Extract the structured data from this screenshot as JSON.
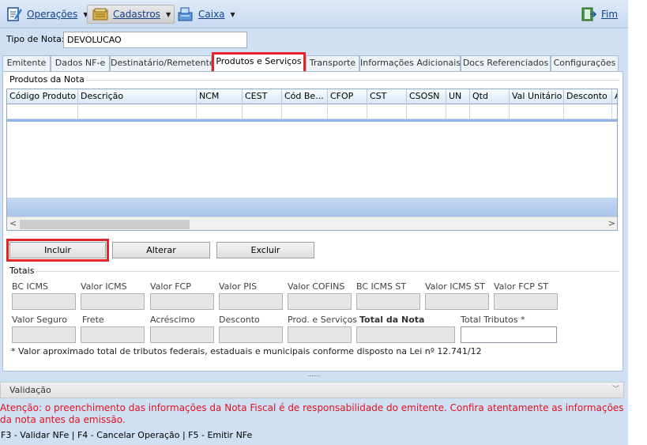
{
  "menubar": {
    "items": [
      {
        "label": "Operações",
        "icon": "operations-icon",
        "active": false
      },
      {
        "label": "Cadastros",
        "icon": "register-icon",
        "active": true
      },
      {
        "label": "Caixa",
        "icon": "cash-register-icon",
        "active": false
      }
    ],
    "exit_label": "Fim"
  },
  "tipo_nota": {
    "label": "Tipo de Nota:",
    "value": "DEVOLUCAO"
  },
  "tabs": [
    {
      "label": "Emitente"
    },
    {
      "label": "Dados NF-e"
    },
    {
      "label": "Destinatário/Remetente"
    },
    {
      "label": "Produtos e Serviços",
      "active": true
    },
    {
      "label": "Transporte"
    },
    {
      "label": "Informações Adicionais"
    },
    {
      "label": "Docs Referenciados"
    },
    {
      "label": "Configurações"
    }
  ],
  "produtos": {
    "group_title": "Produtos da Nota",
    "columns": [
      "Código Produto",
      "Descrição",
      "NCM",
      "CEST",
      "Cód Be...",
      "CFOP",
      "CST",
      "CSOSN",
      "UN",
      "Qtd",
      "Val Unitário",
      "Desconto",
      "A"
    ]
  },
  "actions": {
    "incluir": "Incluir",
    "alterar": "Alterar",
    "excluir": "Excluir"
  },
  "totais": {
    "group_title": "Totais",
    "row1": [
      "BC ICMS",
      "Valor ICMS",
      "Valor FCP",
      "Valor PIS",
      "Valor COFINS",
      "BC ICMS ST",
      "Valor ICMS ST",
      "Valor FCP ST"
    ],
    "row2": [
      "Valor Seguro",
      "Frete",
      "Acréscimo",
      "Desconto",
      "Prod. e Serviços",
      "Total da Nota",
      "Total Tributos *"
    ],
    "footnote": "* Valor aproximado total de tributos federais, estaduais e municipais conforme disposto na Lei nº 12.741/12"
  },
  "validacao": {
    "label": "Validação"
  },
  "warning": "Atenção: o preenchimento das informações da Nota Fiscal é de responsabilidade do emitente. Confira atentamente as informações da nota antes da emissão.",
  "statusbar": "F3 - Validar NFe   | F4 - Cancelar Operação | F5 - Emitir NFe",
  "colors": {
    "highlight": "#e0262b",
    "warning": "#e3111d",
    "menu_text": "#15428b"
  }
}
